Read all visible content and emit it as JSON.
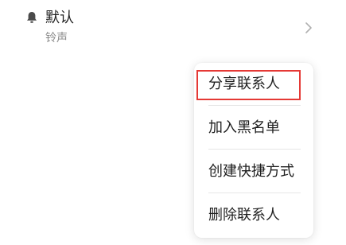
{
  "ringtone": {
    "icon": "bell-icon",
    "value": "默认",
    "label": "铃声",
    "chevron_icon": "chevron-right-icon"
  },
  "context_menu": {
    "items": [
      {
        "label": "分享联系人"
      },
      {
        "label": "加入黑名单"
      },
      {
        "label": "创建快捷方式"
      },
      {
        "label": "删除联系人"
      }
    ],
    "highlight_color": "#e53935"
  }
}
